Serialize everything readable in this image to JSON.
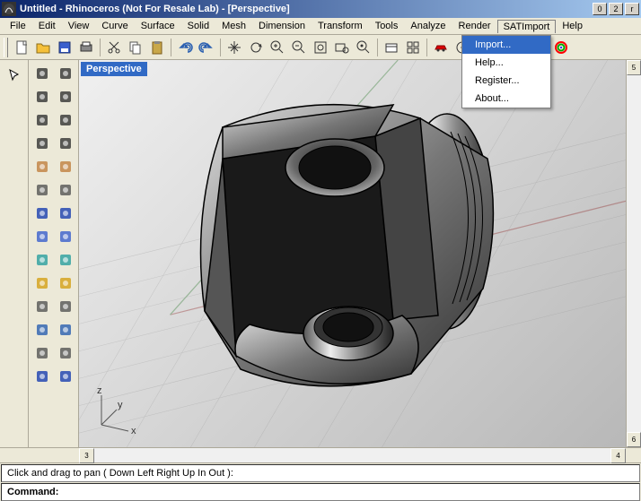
{
  "window": {
    "title": "Untitled - Rhinoceros (Not For Resale Lab) - [Perspective]"
  },
  "menu": {
    "items": [
      "File",
      "Edit",
      "View",
      "Curve",
      "Surface",
      "Solid",
      "Mesh",
      "Dimension",
      "Transform",
      "Tools",
      "Analyze",
      "Render",
      "SATImport",
      "Help"
    ],
    "active_index": 12
  },
  "dropdown": {
    "items": [
      "Import...",
      "Help...",
      "Register...",
      "About..."
    ],
    "highlighted_index": 0
  },
  "toolbar_top": {
    "buttons": [
      "new-file-icon",
      "open-file-icon",
      "save-icon",
      "print-icon",
      "sep",
      "cut-icon",
      "copy-icon",
      "paste-icon",
      "sep",
      "undo-icon",
      "redo-icon",
      "sep",
      "pan-icon",
      "rotate-view-icon",
      "zoom-in-icon",
      "zoom-out-icon",
      "zoom-extents-icon",
      "zoom-window-icon",
      "zoom-selected-icon",
      "sep",
      "named-view-icon",
      "4view-icon",
      "sep",
      "car-icon",
      "snap-icon",
      "sep",
      "osnap-icon",
      "lock-icon",
      "sep",
      "layers-orange-icon",
      "layers-rainbow-icon"
    ]
  },
  "left_toolbar": {
    "buttons": [
      "arrow-select-icon"
    ]
  },
  "side_toolbar": {
    "rows": [
      [
        "point-icon",
        "polyline-icon"
      ],
      [
        "circle-icon",
        "arc-icon"
      ],
      [
        "rectangle-icon",
        "polygon-icon"
      ],
      [
        "rotate-icon",
        "curve-icon"
      ],
      [
        "surface-icon",
        "plane-icon"
      ],
      [
        "corner-icon",
        "line-icon"
      ],
      [
        "explode-icon",
        "offset-icon"
      ],
      [
        "box-icon",
        "sphere-icon"
      ],
      [
        "cylinder-icon",
        "pipe-icon"
      ],
      [
        "gear-icon",
        "explode2-icon"
      ],
      [
        "measure-icon",
        "measure2-icon"
      ],
      [
        "color-icon",
        "colors-icon"
      ],
      [
        "curve2-icon",
        "curve3-icon"
      ],
      [
        "text-icon",
        "text2-icon"
      ]
    ]
  },
  "viewport": {
    "label": "Perspective",
    "axis_labels": {
      "x": "x",
      "y": "y",
      "z": "z"
    }
  },
  "status": {
    "hint": "Click and drag to pan ( Down  Left  Right  Up  In  Out ):",
    "command_label": "Command:",
    "command_value": ""
  }
}
